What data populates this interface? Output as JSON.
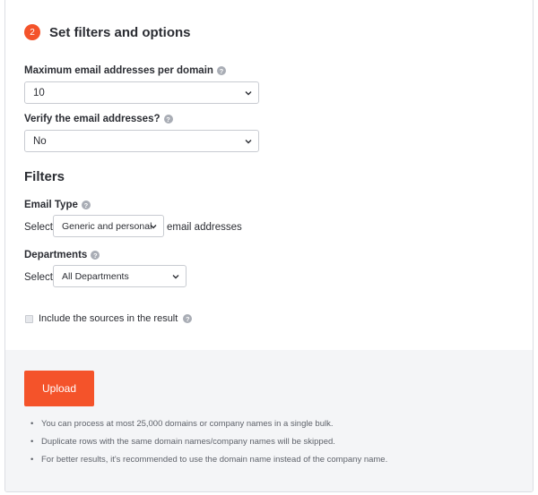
{
  "section": {
    "step": "2",
    "title": "Set filters and options"
  },
  "max_emails": {
    "label": "Maximum email addresses per domain",
    "value": "10"
  },
  "verify": {
    "label": "Verify the email addresses?",
    "value": "No"
  },
  "filters": {
    "title": "Filters",
    "email_type": {
      "label": "Email Type",
      "prefix": "Select",
      "value": "Generic and personal",
      "suffix": "email addresses"
    },
    "departments": {
      "label": "Departments",
      "prefix": "Select",
      "value": "All Departments"
    }
  },
  "include_sources": {
    "label": "Include the sources in the result",
    "checked": false
  },
  "upload_label": "Upload",
  "notes": [
    "You can process at most 25,000 domains or company names in a single bulk.",
    "Duplicate rows with the same domain names/company names will be skipped.",
    "For better results, it's recommended to use the domain name instead of the company name."
  ],
  "colors": {
    "accent": "#f4532a",
    "footer_bg": "#f4f5f7",
    "help_icon": "#a9adb5"
  }
}
